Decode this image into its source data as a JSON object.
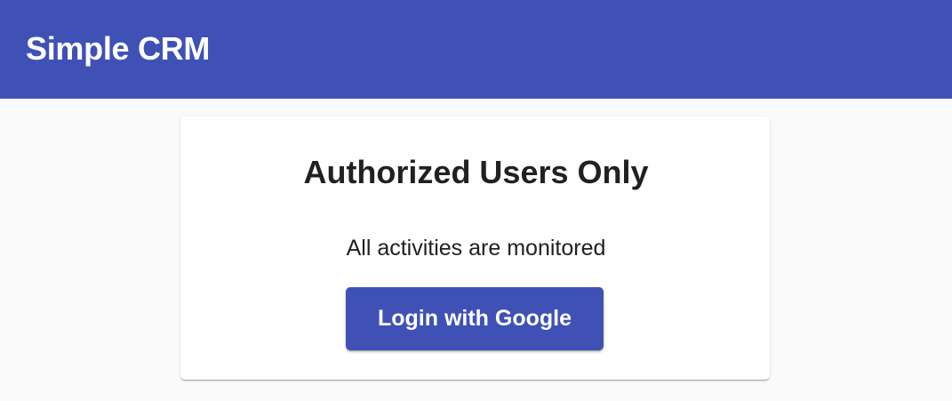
{
  "app": {
    "title": "Simple CRM"
  },
  "login_card": {
    "heading": "Authorized Users Only",
    "notice": "All activities are monitored",
    "login_button_label": "Login with Google"
  },
  "colors": {
    "primary": "#3f51b5",
    "background": "#fafafa",
    "card": "#ffffff",
    "text": "#212121"
  }
}
